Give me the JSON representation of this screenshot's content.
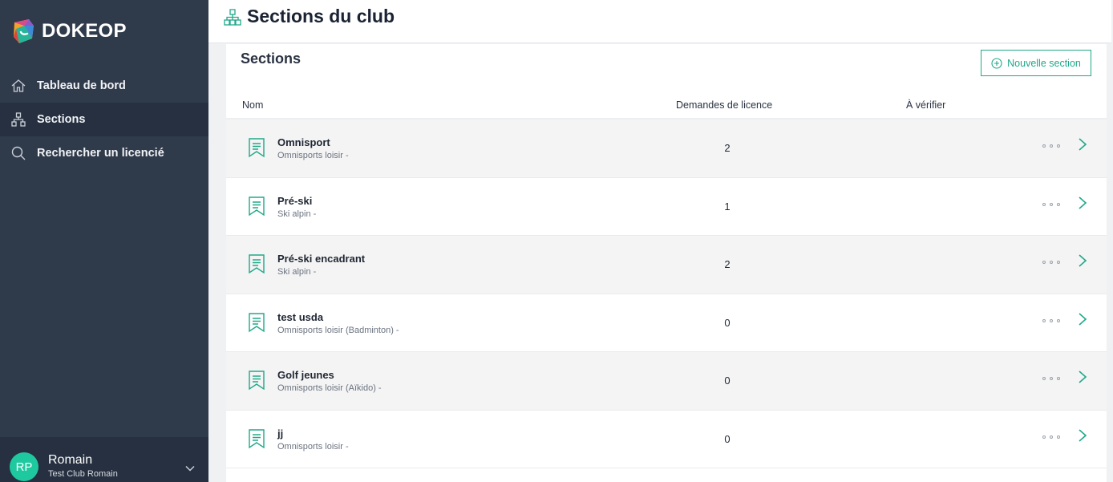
{
  "app": {
    "brand": "DOKEOP"
  },
  "colors": {
    "accent": "#20a88a",
    "sidebar": "#2f3a4a",
    "sidebar_active": "#263040",
    "avatar": "#1fc9a0"
  },
  "sidebar": {
    "items": [
      {
        "label": "Tableau de bord",
        "icon": "home-icon",
        "active": false
      },
      {
        "label": "Sections",
        "icon": "sections-icon",
        "active": true
      },
      {
        "label": "Rechercher un licencié",
        "icon": "search-icon",
        "active": false
      }
    ],
    "user": {
      "initials": "RP",
      "name": "Romain",
      "club": "Test Club Romain"
    }
  },
  "header": {
    "title": "Sections du club",
    "icon": "sections-icon"
  },
  "main": {
    "card_title": "Sections",
    "new_button_label": "Nouvelle section",
    "columns": [
      "Nom",
      "Demandes de licence",
      "À vérifier"
    ],
    "rows": [
      {
        "name": "Omnisport",
        "subtitle": "Omnisports loisir -",
        "requests": "2"
      },
      {
        "name": "Pré-ski",
        "subtitle": "Ski alpin -",
        "requests": "1"
      },
      {
        "name": "Pré-ski encadrant",
        "subtitle": "Ski alpin -",
        "requests": "2"
      },
      {
        "name": "test usda",
        "subtitle": "Omnisports loisir (Badminton) -",
        "requests": "0"
      },
      {
        "name": "Golf jeunes",
        "subtitle": "Omnisports loisir (Aïkido) -",
        "requests": "0"
      },
      {
        "name": "jj",
        "subtitle": "Omnisports loisir -",
        "requests": "0"
      }
    ]
  }
}
